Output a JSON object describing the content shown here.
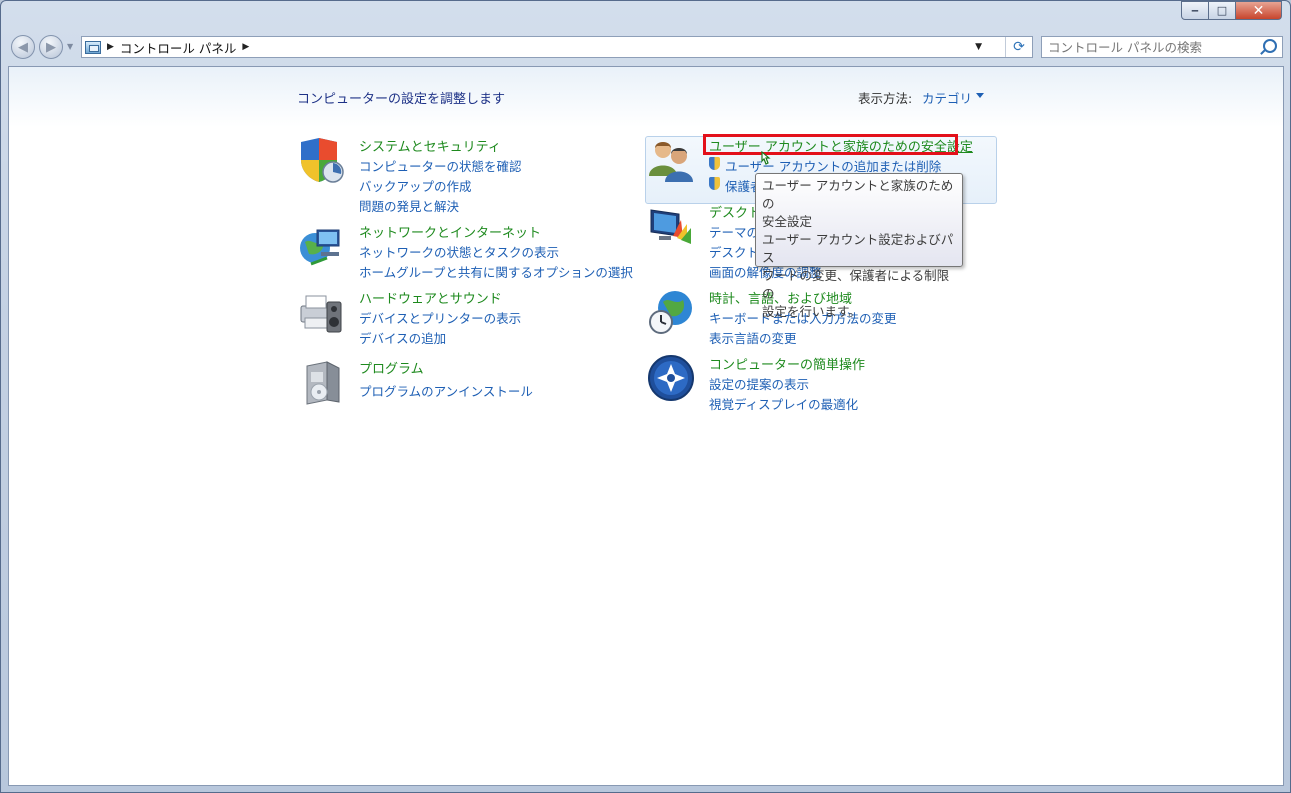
{
  "window": {
    "caption": {
      "minimize": "‒",
      "maximize": "□",
      "close": "✕"
    }
  },
  "nav": {
    "back_glyph": "◀",
    "forward_glyph": "▶",
    "breadcrumb": [
      "コントロール パネル"
    ],
    "refresh_glyph": "⟳"
  },
  "search": {
    "placeholder": "コントロール パネルの検索"
  },
  "page": {
    "title": "コンピューターの設定を調整します",
    "view_by_label": "表示方法:",
    "view_by_value": "カテゴリ"
  },
  "categories": [
    {
      "title": "システムとセキュリティ",
      "icon": "security-shield-icon",
      "links": [
        "コンピューターの状態を確認",
        "バックアップの作成",
        "問題の発見と解決"
      ]
    },
    {
      "title": "ネットワークとインターネット",
      "icon": "network-globe-icon",
      "links": [
        "ネットワークの状態とタスクの表示",
        "ホームグループと共有に関するオプションの選択"
      ]
    },
    {
      "title": "ハードウェアとサウンド",
      "icon": "printer-speaker-icon",
      "links": [
        "デバイスとプリンターの表示",
        "デバイスの追加"
      ]
    },
    {
      "title": "プログラム",
      "icon": "programs-box-icon",
      "links": [
        "プログラムのアンインストール"
      ]
    },
    {
      "title": "ユーザー アカウントと家族のための安全設定",
      "icon": "users-icon",
      "links": [
        "ユーザー アカウントの追加または削除",
        "保護者"
      ]
    },
    {
      "title": "デスクト",
      "icon": "appearance-display-icon",
      "links": [
        "テーマの",
        "デスクト",
        "画面の解像度の調整"
      ]
    },
    {
      "title": "時計、言語、および地域",
      "icon": "clock-globe-icon",
      "links": [
        "キーボードまたは入力方法の変更",
        "表示言語の変更"
      ]
    },
    {
      "title": "コンピューターの簡単操作",
      "icon": "ease-of-access-icon",
      "links": [
        "設定の提案の表示",
        "視覚ディスプレイの最適化"
      ]
    }
  ],
  "tooltip": {
    "lines": [
      "ユーザー アカウントと家族のための",
      "安全設定",
      "ユーザー アカウント設定およびパス",
      "ワードの変更、保護者による制限の",
      "設定を行います。"
    ]
  },
  "colors": {
    "category_title": "#1e8a1e",
    "link": "#1e5fb4",
    "page_title": "#1e3287",
    "highlight_border": "#e3101a"
  }
}
